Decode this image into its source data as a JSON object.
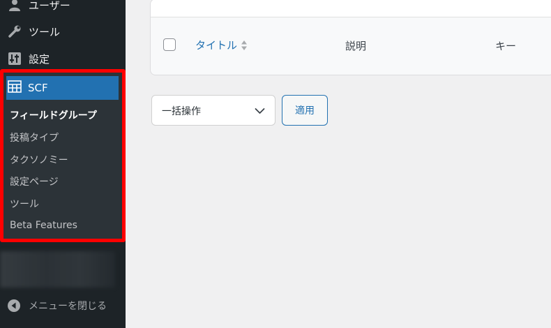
{
  "sidebar": {
    "items": [
      {
        "label": "ユーザー",
        "icon": "user-icon"
      },
      {
        "label": "ツール",
        "icon": "wrench-icon"
      },
      {
        "label": "設定",
        "icon": "settings-sliders-icon"
      }
    ],
    "scf": {
      "label": "SCF",
      "icon": "table-grid-icon",
      "submenu": [
        {
          "label": "フィールドグループ",
          "current": true
        },
        {
          "label": "投稿タイプ"
        },
        {
          "label": "タクソノミー"
        },
        {
          "label": "設定ページ"
        },
        {
          "label": "ツール"
        },
        {
          "label": "Beta Features"
        }
      ]
    },
    "collapse_label": "メニューを閉じる",
    "highlight_color": "#ff0000",
    "active_color": "#2271b1"
  },
  "table": {
    "columns": {
      "title": "タイトル",
      "description": "説明",
      "key": "キー"
    }
  },
  "bulk_actions": {
    "selected": "一括操作",
    "apply_label": "適用"
  }
}
